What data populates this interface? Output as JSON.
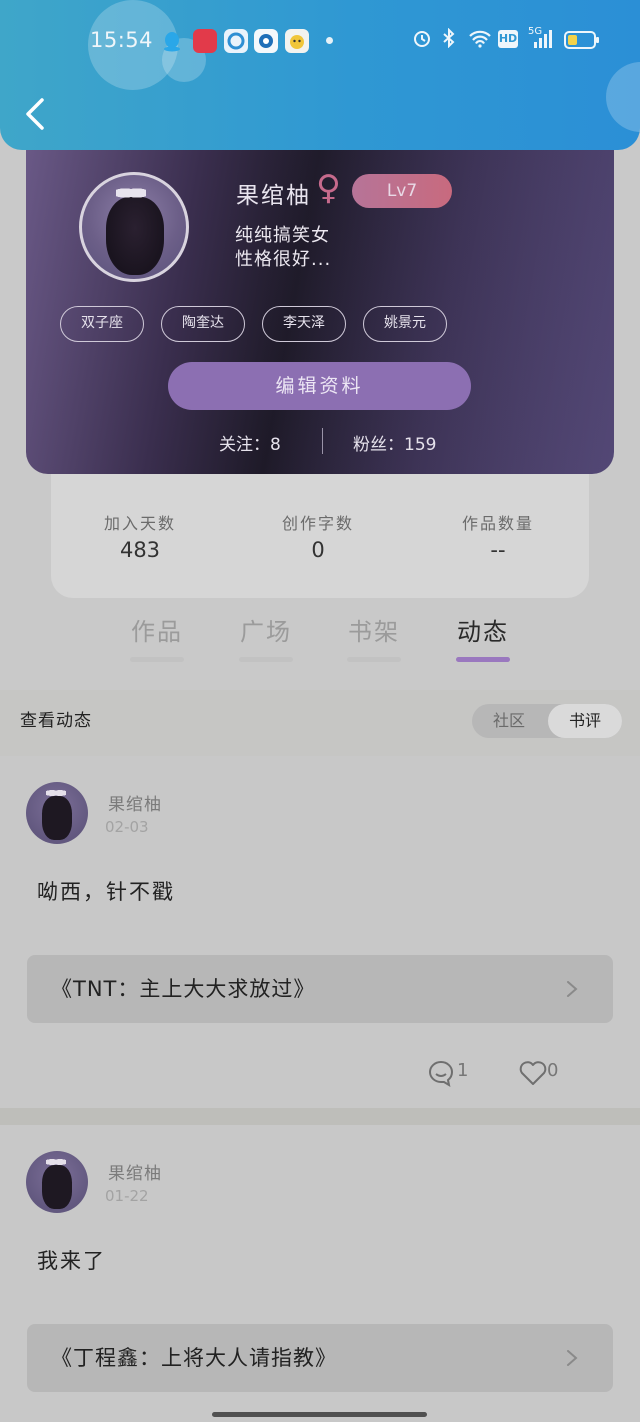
{
  "status_bar": {
    "time": "15:54",
    "app_icons": [
      "qq-icon",
      "shop-icon",
      "browser-icon",
      "circle-app-icon",
      "mascot-icon"
    ],
    "right_icons": [
      "alarm-icon",
      "bluetooth-icon",
      "wifi-icon",
      "hd-icon",
      "signal-5g-icon",
      "battery-icon"
    ],
    "hd_label": "HD",
    "network_label": "5G"
  },
  "profile": {
    "name": "果绾柚",
    "gender_symbol": "♀",
    "level": "Lv7",
    "bio": "纯纯搞笑女\n性格很好...",
    "tags": [
      "双子座",
      "陶奎达",
      "李天泽",
      "姚景元"
    ],
    "edit_label": "编辑资料",
    "follow_text": "关注：8",
    "fans_text": "粉丝：159"
  },
  "stats": [
    {
      "label": "加入天数",
      "value": "483"
    },
    {
      "label": "创作字数",
      "value": "0"
    },
    {
      "label": "作品数量",
      "value": "--"
    }
  ],
  "tabs": [
    {
      "label": "作品",
      "active": false
    },
    {
      "label": "广场",
      "active": false
    },
    {
      "label": "书架",
      "active": false
    },
    {
      "label": "动态",
      "active": true
    }
  ],
  "section": {
    "title": "查看动态",
    "toggle": [
      "社区",
      "书评"
    ],
    "toggle_active": "书评"
  },
  "posts": [
    {
      "author": "果绾柚",
      "date": "02-03",
      "text": "呦西，针不戳",
      "book": "《TNT：主上大大求放过》",
      "comments": "1",
      "likes": "0"
    },
    {
      "author": "果绾柚",
      "date": "01-22",
      "text": "我来了",
      "book": "《丁程鑫：上将大人请指教》"
    }
  ],
  "colors": {
    "header": "#2f98d3",
    "accent_purple": "#9a78bf",
    "level_badge": "#c86a7e",
    "female": "#c66a8c"
  }
}
